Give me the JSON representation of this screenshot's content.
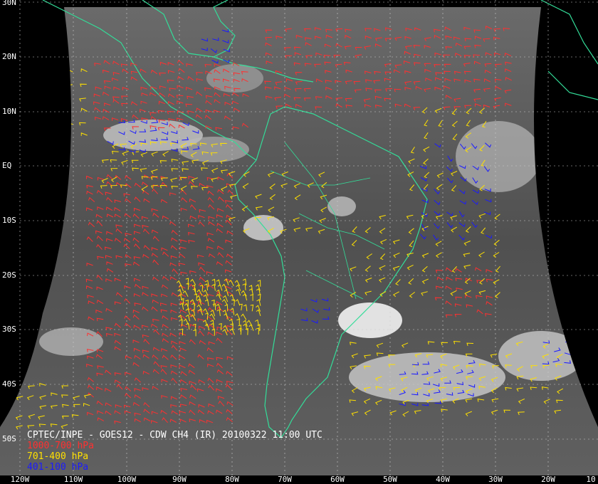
{
  "caption": "CPTEC/INPE - GOES12 - CDW CH4 (IR) 20100322 11:00 UTC",
  "legend": [
    {
      "label": "1000-700 hPa",
      "color": "#ff3030"
    },
    {
      "label": "701-400 hPa",
      "color": "#ffe000"
    },
    {
      "label": "401-100 hPa",
      "color": "#1a1aff"
    }
  ],
  "lat_labels": [
    "30N",
    "20N",
    "10N",
    "EQ",
    "10S",
    "20S",
    "30S",
    "40S",
    "50S"
  ],
  "lon_labels": [
    "120W",
    "110W",
    "100W",
    "90W",
    "80W",
    "70W",
    "60W",
    "50W",
    "40W",
    "30W",
    "20W",
    "10"
  ],
  "colors": {
    "background": "#000000",
    "satellite_gray": "#5a5a5a",
    "coastline": "#33dd99",
    "grid": "#cccccc"
  }
}
